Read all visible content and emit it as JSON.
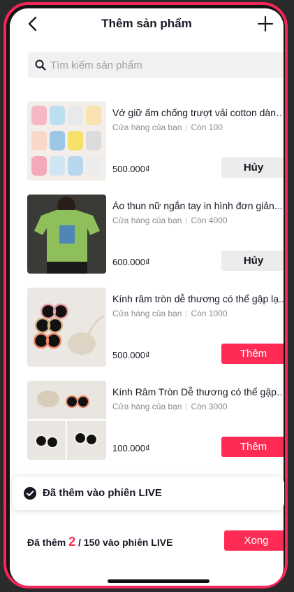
{
  "header": {
    "title": "Thêm sản phẩm"
  },
  "search": {
    "placeholder": "Tìm kiếm sản phẩm"
  },
  "products": [
    {
      "name": "Vớ giữ ấm chống trượt vải cotton dành...",
      "store": "Cửa hàng của bạn",
      "stock": "Còn 100",
      "price": "500.000₫",
      "action": "Hủy"
    },
    {
      "name": "Áo thun nữ ngắn tay in hình đơn giản...",
      "store": "Cửa hàng của bạn",
      "stock": "Còn 4000",
      "price": "600.000₫",
      "action": "Hủy"
    },
    {
      "name": "Kính râm tròn dễ thương có thể gập lạ...",
      "store": "Cửa hàng của bạn",
      "stock": "Còn 1000",
      "price": "500.000₫",
      "action": "Thêm"
    },
    {
      "name": "Kính Râm Tròn Dễ thương có thể gập l...",
      "store": "Cửa hàng của bạn",
      "stock": "Còn 3000",
      "price": "100.000₫",
      "action": "Thêm"
    }
  ],
  "toast": {
    "message": "Đã thêm vào phiên LIVE"
  },
  "footer": {
    "prefix": "Đã thêm",
    "count": "2",
    "suffix": "/ 150 vào phiên LIVE",
    "done_label": "Xong"
  },
  "colors": {
    "accent": "#fe2c55",
    "frame": "#f5265a"
  }
}
